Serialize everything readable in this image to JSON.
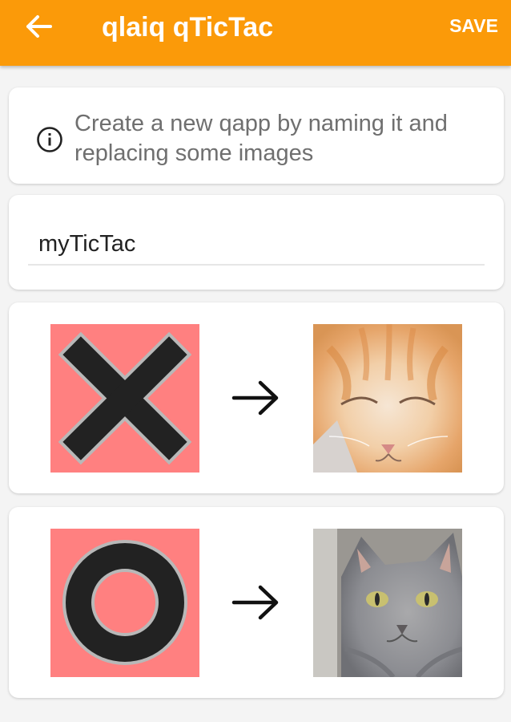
{
  "app_bar": {
    "back_icon": "arrow-left-icon",
    "title": "qlaiq qTicTac",
    "save_label": "SAVE",
    "color": "#fb9a09"
  },
  "info": {
    "icon": "info-circle-icon",
    "text": "Create a new qapp by naming it and replacing some images"
  },
  "name_field": {
    "value": "myTicTac"
  },
  "replacements": [
    {
      "original": "x-symbol",
      "arrow_icon": "arrow-right-icon",
      "replacement": "orange-cat-photo"
    },
    {
      "original": "o-symbol",
      "arrow_icon": "arrow-right-icon",
      "replacement": "gray-cat-photo"
    }
  ],
  "colors": {
    "tile_background": "#ff8080",
    "symbol": "#222222"
  }
}
